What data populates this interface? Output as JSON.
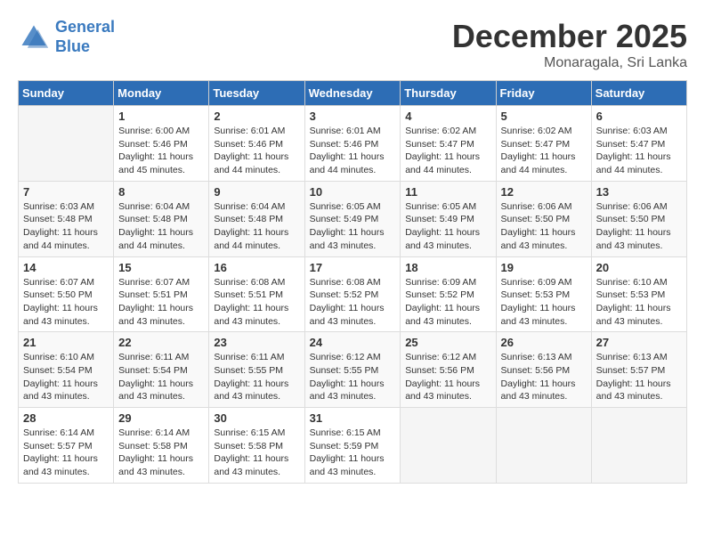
{
  "logo": {
    "line1": "General",
    "line2": "Blue"
  },
  "title": "December 2025",
  "location": "Monaragala, Sri Lanka",
  "days_header": [
    "Sunday",
    "Monday",
    "Tuesday",
    "Wednesday",
    "Thursday",
    "Friday",
    "Saturday"
  ],
  "weeks": [
    [
      {
        "day": "",
        "sunrise": "",
        "sunset": "",
        "daylight": ""
      },
      {
        "day": "1",
        "sunrise": "Sunrise: 6:00 AM",
        "sunset": "Sunset: 5:46 PM",
        "daylight": "Daylight: 11 hours and 45 minutes."
      },
      {
        "day": "2",
        "sunrise": "Sunrise: 6:01 AM",
        "sunset": "Sunset: 5:46 PM",
        "daylight": "Daylight: 11 hours and 44 minutes."
      },
      {
        "day": "3",
        "sunrise": "Sunrise: 6:01 AM",
        "sunset": "Sunset: 5:46 PM",
        "daylight": "Daylight: 11 hours and 44 minutes."
      },
      {
        "day": "4",
        "sunrise": "Sunrise: 6:02 AM",
        "sunset": "Sunset: 5:47 PM",
        "daylight": "Daylight: 11 hours and 44 minutes."
      },
      {
        "day": "5",
        "sunrise": "Sunrise: 6:02 AM",
        "sunset": "Sunset: 5:47 PM",
        "daylight": "Daylight: 11 hours and 44 minutes."
      },
      {
        "day": "6",
        "sunrise": "Sunrise: 6:03 AM",
        "sunset": "Sunset: 5:47 PM",
        "daylight": "Daylight: 11 hours and 44 minutes."
      }
    ],
    [
      {
        "day": "7",
        "sunrise": "Sunrise: 6:03 AM",
        "sunset": "Sunset: 5:48 PM",
        "daylight": "Daylight: 11 hours and 44 minutes."
      },
      {
        "day": "8",
        "sunrise": "Sunrise: 6:04 AM",
        "sunset": "Sunset: 5:48 PM",
        "daylight": "Daylight: 11 hours and 44 minutes."
      },
      {
        "day": "9",
        "sunrise": "Sunrise: 6:04 AM",
        "sunset": "Sunset: 5:48 PM",
        "daylight": "Daylight: 11 hours and 44 minutes."
      },
      {
        "day": "10",
        "sunrise": "Sunrise: 6:05 AM",
        "sunset": "Sunset: 5:49 PM",
        "daylight": "Daylight: 11 hours and 43 minutes."
      },
      {
        "day": "11",
        "sunrise": "Sunrise: 6:05 AM",
        "sunset": "Sunset: 5:49 PM",
        "daylight": "Daylight: 11 hours and 43 minutes."
      },
      {
        "day": "12",
        "sunrise": "Sunrise: 6:06 AM",
        "sunset": "Sunset: 5:50 PM",
        "daylight": "Daylight: 11 hours and 43 minutes."
      },
      {
        "day": "13",
        "sunrise": "Sunrise: 6:06 AM",
        "sunset": "Sunset: 5:50 PM",
        "daylight": "Daylight: 11 hours and 43 minutes."
      }
    ],
    [
      {
        "day": "14",
        "sunrise": "Sunrise: 6:07 AM",
        "sunset": "Sunset: 5:50 PM",
        "daylight": "Daylight: 11 hours and 43 minutes."
      },
      {
        "day": "15",
        "sunrise": "Sunrise: 6:07 AM",
        "sunset": "Sunset: 5:51 PM",
        "daylight": "Daylight: 11 hours and 43 minutes."
      },
      {
        "day": "16",
        "sunrise": "Sunrise: 6:08 AM",
        "sunset": "Sunset: 5:51 PM",
        "daylight": "Daylight: 11 hours and 43 minutes."
      },
      {
        "day": "17",
        "sunrise": "Sunrise: 6:08 AM",
        "sunset": "Sunset: 5:52 PM",
        "daylight": "Daylight: 11 hours and 43 minutes."
      },
      {
        "day": "18",
        "sunrise": "Sunrise: 6:09 AM",
        "sunset": "Sunset: 5:52 PM",
        "daylight": "Daylight: 11 hours and 43 minutes."
      },
      {
        "day": "19",
        "sunrise": "Sunrise: 6:09 AM",
        "sunset": "Sunset: 5:53 PM",
        "daylight": "Daylight: 11 hours and 43 minutes."
      },
      {
        "day": "20",
        "sunrise": "Sunrise: 6:10 AM",
        "sunset": "Sunset: 5:53 PM",
        "daylight": "Daylight: 11 hours and 43 minutes."
      }
    ],
    [
      {
        "day": "21",
        "sunrise": "Sunrise: 6:10 AM",
        "sunset": "Sunset: 5:54 PM",
        "daylight": "Daylight: 11 hours and 43 minutes."
      },
      {
        "day": "22",
        "sunrise": "Sunrise: 6:11 AM",
        "sunset": "Sunset: 5:54 PM",
        "daylight": "Daylight: 11 hours and 43 minutes."
      },
      {
        "day": "23",
        "sunrise": "Sunrise: 6:11 AM",
        "sunset": "Sunset: 5:55 PM",
        "daylight": "Daylight: 11 hours and 43 minutes."
      },
      {
        "day": "24",
        "sunrise": "Sunrise: 6:12 AM",
        "sunset": "Sunset: 5:55 PM",
        "daylight": "Daylight: 11 hours and 43 minutes."
      },
      {
        "day": "25",
        "sunrise": "Sunrise: 6:12 AM",
        "sunset": "Sunset: 5:56 PM",
        "daylight": "Daylight: 11 hours and 43 minutes."
      },
      {
        "day": "26",
        "sunrise": "Sunrise: 6:13 AM",
        "sunset": "Sunset: 5:56 PM",
        "daylight": "Daylight: 11 hours and 43 minutes."
      },
      {
        "day": "27",
        "sunrise": "Sunrise: 6:13 AM",
        "sunset": "Sunset: 5:57 PM",
        "daylight": "Daylight: 11 hours and 43 minutes."
      }
    ],
    [
      {
        "day": "28",
        "sunrise": "Sunrise: 6:14 AM",
        "sunset": "Sunset: 5:57 PM",
        "daylight": "Daylight: 11 hours and 43 minutes."
      },
      {
        "day": "29",
        "sunrise": "Sunrise: 6:14 AM",
        "sunset": "Sunset: 5:58 PM",
        "daylight": "Daylight: 11 hours and 43 minutes."
      },
      {
        "day": "30",
        "sunrise": "Sunrise: 6:15 AM",
        "sunset": "Sunset: 5:58 PM",
        "daylight": "Daylight: 11 hours and 43 minutes."
      },
      {
        "day": "31",
        "sunrise": "Sunrise: 6:15 AM",
        "sunset": "Sunset: 5:59 PM",
        "daylight": "Daylight: 11 hours and 43 minutes."
      },
      {
        "day": "",
        "sunrise": "",
        "sunset": "",
        "daylight": ""
      },
      {
        "day": "",
        "sunrise": "",
        "sunset": "",
        "daylight": ""
      },
      {
        "day": "",
        "sunrise": "",
        "sunset": "",
        "daylight": ""
      }
    ]
  ]
}
